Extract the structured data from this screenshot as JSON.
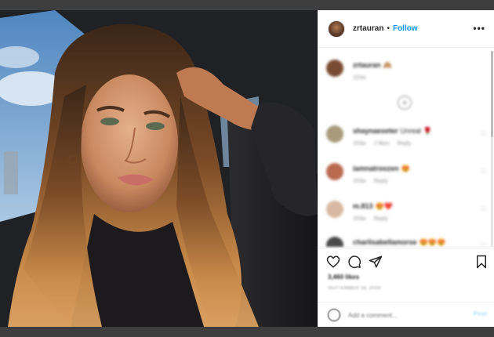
{
  "post": {
    "username": "zrtauran",
    "separator": "•",
    "follow_label": "Follow",
    "more_icon": "more-horizontal-icon"
  },
  "comments": [
    {
      "user": "zrtauran",
      "text": "🙈",
      "meta": [
        "153w"
      ],
      "avatar": "#7a4b33"
    },
    {
      "user": "shaynaexeter",
      "text": "Unreal 🌹",
      "meta": [
        "153w",
        "2 likes",
        "Reply"
      ],
      "avatar": "#a89a7a"
    },
    {
      "user": "iamnatroozen",
      "text": "😍",
      "meta": [
        "153w",
        "Reply"
      ],
      "avatar": "#b8694e"
    },
    {
      "user": "m.813",
      "text": "😍❤️",
      "meta": [
        "153w",
        "Reply"
      ],
      "avatar": "#d8b8a0"
    },
    {
      "user": "charlisabellamorse",
      "text": "😍😍😍",
      "meta": [],
      "avatar": "#4a4a4a"
    }
  ],
  "stats": {
    "likes": "3,460 likes",
    "date": "SEPTEMBER 16, 2016"
  },
  "composer": {
    "placeholder": "Add a comment...",
    "post_label": "Post"
  },
  "colors": {
    "accent": "#0095f6",
    "post_disabled": "#b2dffc",
    "backdrop": "#3e3e3e"
  }
}
